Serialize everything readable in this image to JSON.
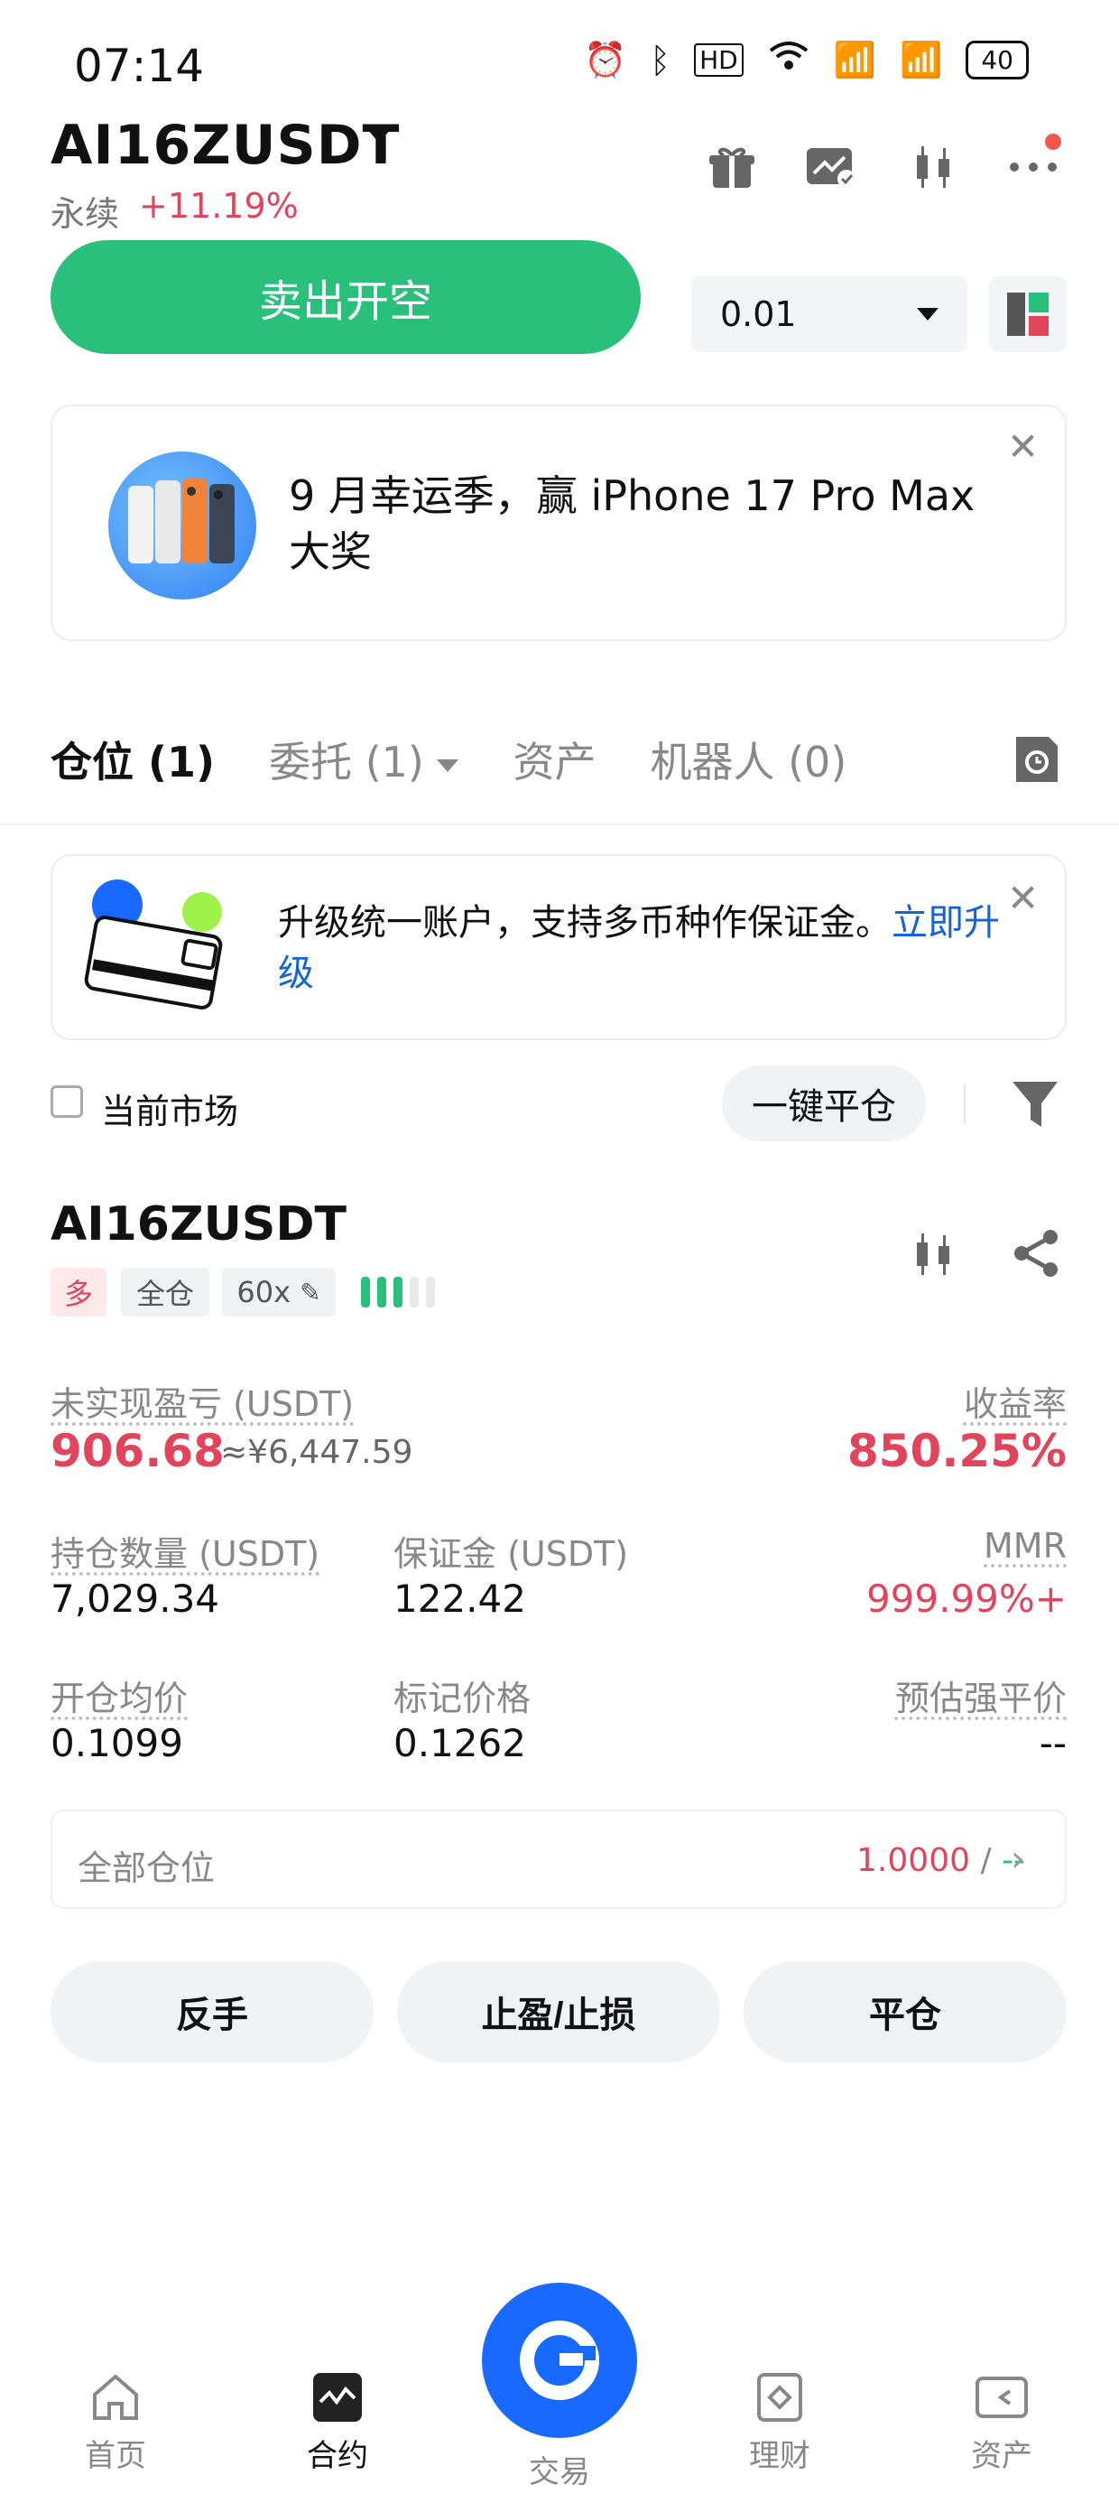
{
  "status_bar": {
    "time": "07:14",
    "right_text": "HD",
    "battery": "40"
  },
  "header": {
    "pair": "AI16ZUSDT",
    "contract_type": "永续",
    "change": "+11.19%"
  },
  "order": {
    "sell_label": "卖出开空",
    "quantity": "0.01"
  },
  "banner": {
    "text": "9 月幸运季，赢 iPhone 17 Pro Max 大奖"
  },
  "tabs": [
    {
      "label": "仓位 (1)"
    },
    {
      "label": "委托 (1)"
    },
    {
      "label": "资产"
    },
    {
      "label": "机器人 (0)"
    }
  ],
  "promo": {
    "text": "升级统一账户，支持多币种作保证金。",
    "link": "立即升级"
  },
  "filter": {
    "current_market": "当前市场",
    "close_all": "一键平仓"
  },
  "position": {
    "symbol": "AI16ZUSDT",
    "side": "多",
    "margin_mode": "全仓",
    "leverage": "60x",
    "unrealized_pnl_label": "未实现盈亏 (USDT)",
    "unrealized_pnl": "906.68",
    "unrealized_pnl_cny": "≈¥6,447.59",
    "roe_label": "收益率",
    "roe": "850.25%",
    "size_label": "持仓数量 (USDT)",
    "size": "7,029.34",
    "margin_label": "保证金 (USDT)",
    "margin": "122.42",
    "mmr_label": "MMR",
    "mmr": "999.99%+",
    "entry_label": "开仓均价",
    "entry": "0.1099",
    "mark_label": "标记价格",
    "mark": "0.1262",
    "liq_label": "预估强平价",
    "liq": "--"
  },
  "all_positions": {
    "label": "全部仓位",
    "value": "1.0000",
    "sep": " / ",
    "value2": "--"
  },
  "actions": {
    "reverse": "反手",
    "tpsl": "止盈/止损",
    "close": "平仓"
  },
  "nav": [
    {
      "label": "首页"
    },
    {
      "label": "合约"
    },
    {
      "label": "交易"
    },
    {
      "label": "理财"
    },
    {
      "label": "资产"
    }
  ],
  "colors": {
    "green": "#28c07a",
    "red": "#e2455b",
    "blue": "#1769ff"
  }
}
